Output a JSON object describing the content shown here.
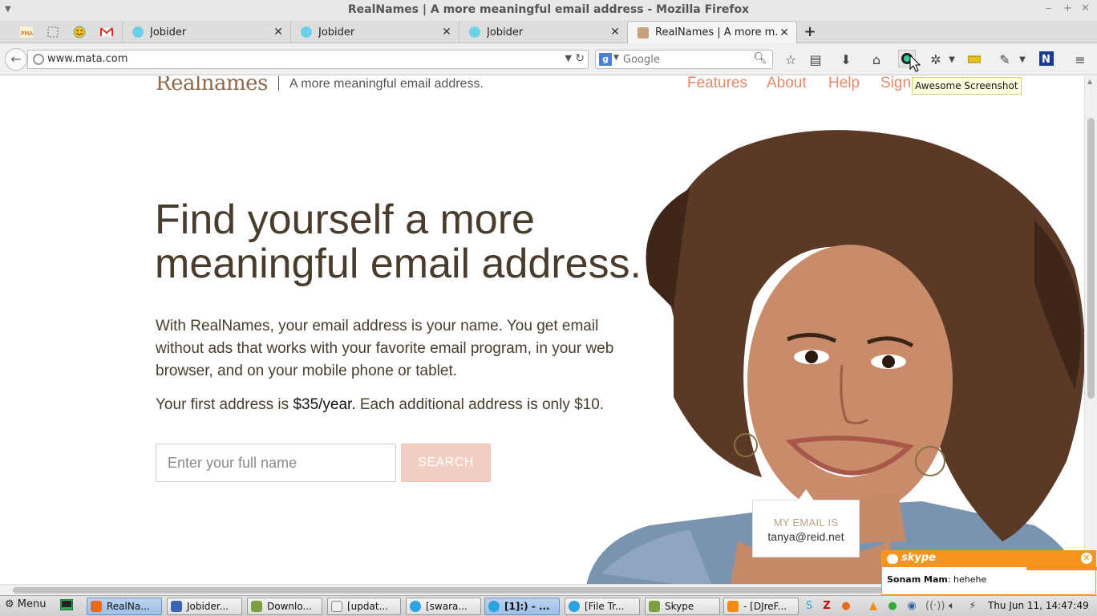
{
  "window": {
    "title": "RealNames | A more meaningful email address - Mozilla Firefox"
  },
  "tabs": [
    {
      "title": "Jobider"
    },
    {
      "title": "Jobider"
    },
    {
      "title": "Jobider"
    },
    {
      "title": "RealNames | A more m..."
    }
  ],
  "nav": {
    "url": "www.mata.com",
    "search_placeholder": "Google"
  },
  "tooltip": "Awesome Screenshot",
  "site": {
    "logo": "Realnames",
    "tagline": "A more meaningful email address.",
    "links": [
      "Features",
      "About",
      "Help",
      "Sign"
    ],
    "headline": "Find yourself a more meaningful email address.",
    "body": "With RealNames, your email address is your name. You get email without ads that works with your favorite email program, in your web browser, and on your mobile phone or tablet.",
    "pricing_prefix": "Your first address is ",
    "pricing_price": "$35/year.",
    "pricing_suffix": " Each additional address is only $10.",
    "name_placeholder": "Enter your full name",
    "search_label": "SEARCH",
    "email_card_label": "MY EMAIL IS",
    "email_card_address": "tanya@reid.net"
  },
  "skype_popup": {
    "brand": "skype",
    "sender": "Sonam Mam",
    "message": ": hehehe"
  },
  "taskbar": {
    "menu_label": "Menu",
    "items": [
      {
        "label": "RealNa..."
      },
      {
        "label": "Jobider..."
      },
      {
        "label": "Downlo..."
      },
      {
        "label": "[updat..."
      },
      {
        "label": "[swara..."
      },
      {
        "label": "[1]:) - ..."
      },
      {
        "label": "[File Tr..."
      },
      {
        "label": "Skype"
      },
      {
        "label": "- [DJreF..."
      }
    ],
    "clock": "Thu Jun 11, 14:47:49"
  },
  "colors": {
    "accent": "#e08a68",
    "search_button": "#f2cfc2",
    "text": "#4a3c2c",
    "skype": "#f7941e"
  }
}
